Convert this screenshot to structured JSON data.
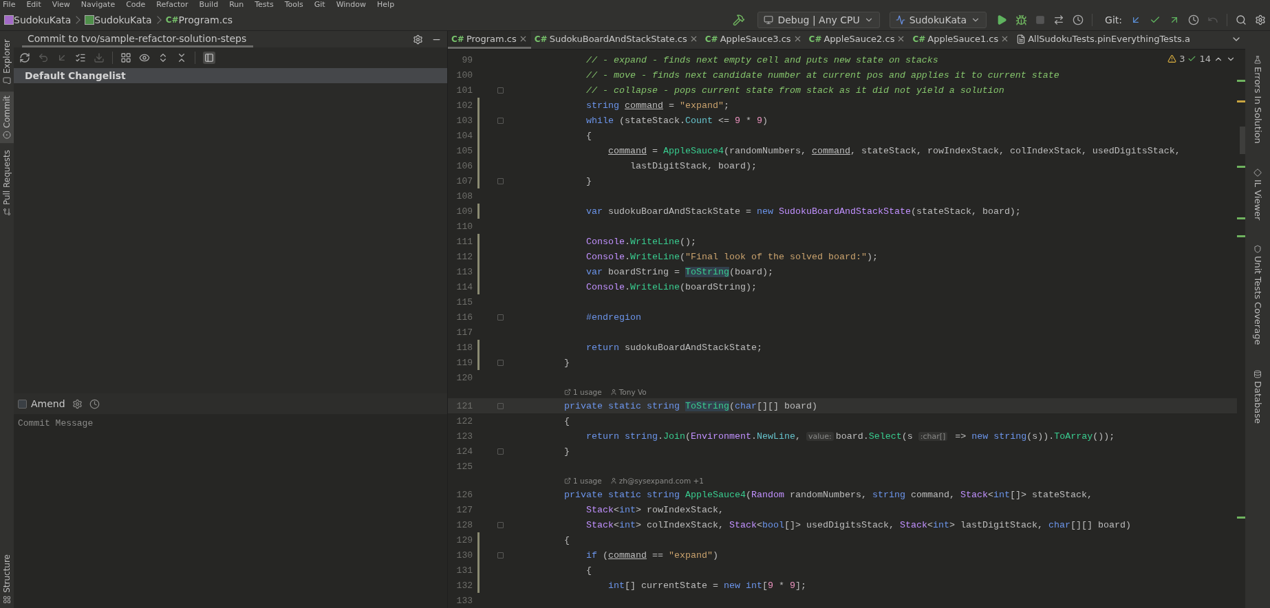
{
  "menu": [
    "File",
    "Edit",
    "View",
    "Navigate",
    "Code",
    "Refactor",
    "Build",
    "Run",
    "Tests",
    "Tools",
    "Git",
    "Window",
    "Help"
  ],
  "breadcrumbs": [
    {
      "kind": "solution",
      "label": "SudokuKata"
    },
    {
      "kind": "project",
      "label": "SudokuKata"
    },
    {
      "kind": "file",
      "badge": "C#",
      "label": "Program.cs"
    }
  ],
  "toolbar": {
    "build_config": "Debug | Any CPU",
    "run_config": "SudokuKata",
    "git_label": "Git:"
  },
  "left_stripe": [
    {
      "label": "Explorer",
      "selected": false
    },
    {
      "label": "Commit",
      "selected": true
    },
    {
      "label": "Pull Requests",
      "selected": false
    }
  ],
  "left_stripe_bottom": [
    "Structure"
  ],
  "commit_panel": {
    "title": "Commit to tvo/sample-refactor-solution-steps",
    "changelists": [
      {
        "label": "Default Changelist",
        "selected": true
      }
    ],
    "amend": {
      "label": "Amend",
      "checked": false
    },
    "message": {
      "placeholder": "Commit Message"
    }
  },
  "tabs": [
    {
      "badge": "C#",
      "label": "Program.cs",
      "selected": true,
      "closable": true
    },
    {
      "badge": "C#",
      "label": "SudokuBoardAndStackState.cs",
      "selected": false,
      "closable": true
    },
    {
      "badge": "C#",
      "label": "AppleSauce3.cs",
      "selected": false,
      "closable": true
    },
    {
      "badge": "C#",
      "label": "AppleSauce2.cs",
      "selected": false,
      "closable": true
    },
    {
      "badge": "C#",
      "label": "AppleSauce1.cs",
      "selected": false,
      "closable": true
    },
    {
      "label": "AllSudokuTests.pinEverythingTests.a",
      "selected": false,
      "closable": false
    }
  ],
  "inspections": {
    "warnings": "3",
    "passed": "14"
  },
  "lines": [
    {
      "kind": "code",
      "number": "99",
      "modified": false,
      "fold": false,
      "tokens": [
        {
          "kind": "comment",
          "t": "            // - expand - finds next empty cell and puts new state on stacks"
        }
      ]
    },
    {
      "kind": "code",
      "number": "100",
      "modified": false,
      "fold": false,
      "tokens": [
        {
          "kind": "comment",
          "t": "            // - move - finds next candidate number at current pos and applies it to current state"
        }
      ]
    },
    {
      "kind": "code",
      "number": "101",
      "modified": false,
      "fold": true,
      "tokens": [
        {
          "kind": "comment",
          "t": "            // - collapse - pops current state from stack as it did not yield a solution"
        }
      ]
    },
    {
      "kind": "code",
      "number": "102",
      "modified": true,
      "fold": false,
      "tokens": [
        {
          "kind": "kw",
          "t": "            string "
        },
        {
          "kind": "ul",
          "t": "command"
        },
        {
          "kind": "plain",
          "t": " = "
        },
        {
          "kind": "str",
          "t": "\"expand\""
        },
        {
          "kind": "plain",
          "t": ";"
        }
      ]
    },
    {
      "kind": "code",
      "number": "103",
      "modified": true,
      "fold": true,
      "tokens": [
        {
          "kind": "kw",
          "t": "            while"
        },
        {
          "kind": "plain",
          "t": " (stateStack."
        },
        {
          "kind": "field",
          "t": "Count"
        },
        {
          "kind": "plain",
          "t": " <= "
        },
        {
          "kind": "num",
          "t": "9"
        },
        {
          "kind": "plain",
          "t": " * "
        },
        {
          "kind": "num",
          "t": "9"
        },
        {
          "kind": "plain",
          "t": ")"
        }
      ]
    },
    {
      "kind": "code",
      "number": "104",
      "modified": true,
      "fold": false,
      "tokens": [
        {
          "kind": "plain",
          "t": "            {"
        }
      ]
    },
    {
      "kind": "code",
      "number": "105",
      "modified": true,
      "fold": false,
      "tokens": [
        {
          "kind": "ul",
          "t": "                command"
        },
        {
          "kind": "plain",
          "t": " = "
        },
        {
          "kind": "method",
          "t": "AppleSauce4"
        },
        {
          "kind": "plain",
          "t": "(randomNumbers, "
        },
        {
          "kind": "ul",
          "t": "command"
        },
        {
          "kind": "plain",
          "t": ", stateStack, rowIndexStack, colIndexStack, usedDigitsStack,"
        }
      ]
    },
    {
      "kind": "code",
      "number": "106",
      "modified": true,
      "fold": false,
      "tokens": [
        {
          "kind": "plain",
          "t": "                    lastDigitStack, board);"
        }
      ]
    },
    {
      "kind": "code",
      "number": "107",
      "modified": true,
      "fold": true,
      "tokens": [
        {
          "kind": "plain",
          "t": "            }"
        }
      ]
    },
    {
      "kind": "code",
      "number": "108",
      "modified": false,
      "fold": false
    },
    {
      "kind": "code",
      "number": "109",
      "modified": true,
      "fold": false,
      "tokens": [
        {
          "kind": "kw",
          "t": "            var"
        },
        {
          "kind": "plain",
          "t": " sudokuBoardAndStackState = "
        },
        {
          "kind": "kw",
          "t": "new "
        },
        {
          "kind": "type",
          "t": "SudokuBoardAndStackState"
        },
        {
          "kind": "plain",
          "t": "(stateStack, board);"
        }
      ]
    },
    {
      "kind": "code",
      "number": "110",
      "modified": false,
      "fold": false
    },
    {
      "kind": "code",
      "number": "111",
      "modified": true,
      "fold": false,
      "tokens": [
        {
          "kind": "type",
          "t": "            Console"
        },
        {
          "kind": "plain",
          "t": "."
        },
        {
          "kind": "method",
          "t": "WriteLine"
        },
        {
          "kind": "plain",
          "t": "();"
        }
      ]
    },
    {
      "kind": "code",
      "number": "112",
      "modified": true,
      "fold": false,
      "tokens": [
        {
          "kind": "type",
          "t": "            Console"
        },
        {
          "kind": "plain",
          "t": "."
        },
        {
          "kind": "method",
          "t": "WriteLine"
        },
        {
          "kind": "plain",
          "t": "("
        },
        {
          "kind": "str",
          "t": "\"Final look of the solved board:\""
        },
        {
          "kind": "plain",
          "t": ");"
        }
      ]
    },
    {
      "kind": "code",
      "number": "113",
      "modified": true,
      "fold": false,
      "tokens": [
        {
          "kind": "kw",
          "t": "            var"
        },
        {
          "kind": "plain",
          "t": " boardString = "
        },
        {
          "kind": "hl",
          "t": "ToString"
        },
        {
          "kind": "plain",
          "t": "(board);"
        }
      ]
    },
    {
      "kind": "code",
      "number": "114",
      "modified": true,
      "fold": false,
      "tokens": [
        {
          "kind": "type",
          "t": "            Console"
        },
        {
          "kind": "plain",
          "t": "."
        },
        {
          "kind": "method",
          "t": "WriteLine"
        },
        {
          "kind": "plain",
          "t": "(boardString);"
        }
      ]
    },
    {
      "kind": "code",
      "number": "115",
      "modified": false,
      "fold": false
    },
    {
      "kind": "code",
      "number": "116",
      "modified": false,
      "fold": true,
      "tokens": [
        {
          "kind": "kw",
          "t": "            #endregion"
        }
      ]
    },
    {
      "kind": "code",
      "number": "117",
      "modified": false,
      "fold": false
    },
    {
      "kind": "code",
      "number": "118",
      "modified": true,
      "fold": false,
      "tokens": [
        {
          "kind": "kw",
          "t": "            return"
        },
        {
          "kind": "plain",
          "t": " sudokuBoardAndStackState;"
        }
      ]
    },
    {
      "kind": "code",
      "number": "119",
      "modified": true,
      "fold": true,
      "tokens": [
        {
          "kind": "plain",
          "t": "        }"
        }
      ]
    },
    {
      "kind": "code",
      "number": "120",
      "modified": false,
      "fold": false
    },
    {
      "kind": "lens",
      "usages": "1 usage",
      "author": "Tony Vo"
    },
    {
      "kind": "code",
      "number": "121",
      "modified": false,
      "fold": true,
      "current": true,
      "tokens": [
        {
          "kind": "kw",
          "t": "        private static string "
        },
        {
          "kind": "hl",
          "t": "ToString"
        },
        {
          "kind": "plain",
          "t": "("
        },
        {
          "kind": "kw",
          "t": "char"
        },
        {
          "kind": "plain",
          "t": "[][] board)"
        }
      ]
    },
    {
      "kind": "code",
      "number": "122",
      "modified": false,
      "fold": false,
      "tokens": [
        {
          "kind": "plain",
          "t": "        {"
        }
      ]
    },
    {
      "kind": "code",
      "number": "123",
      "modified": false,
      "fold": false,
      "tokens": [
        {
          "kind": "kw",
          "t": "            return string"
        },
        {
          "kind": "plain",
          "t": "."
        },
        {
          "kind": "method",
          "t": "Join"
        },
        {
          "kind": "plain",
          "t": "("
        },
        {
          "kind": "type",
          "t": "Environment"
        },
        {
          "kind": "plain",
          "t": "."
        },
        {
          "kind": "field",
          "t": "NewLine"
        },
        {
          "kind": "plain",
          "t": ","
        },
        {
          "kind": "hint",
          "t": "value:"
        },
        {
          "kind": "plain",
          "t": "board."
        },
        {
          "kind": "method",
          "t": "Select"
        },
        {
          "kind": "plain",
          "t": "(s"
        },
        {
          "kind": "hint",
          "t": ":char[]"
        },
        {
          "kind": "plain",
          "t": " => "
        },
        {
          "kind": "kw",
          "t": "new string"
        },
        {
          "kind": "plain",
          "t": "(s))."
        },
        {
          "kind": "method",
          "t": "ToArray"
        },
        {
          "kind": "plain",
          "t": "());"
        }
      ]
    },
    {
      "kind": "code",
      "number": "124",
      "modified": false,
      "fold": true,
      "tokens": [
        {
          "kind": "plain",
          "t": "        }"
        }
      ]
    },
    {
      "kind": "code",
      "number": "125",
      "modified": false,
      "fold": false
    },
    {
      "kind": "lens",
      "usages": "1 usage",
      "author": "zh@sysexpand.com +1"
    },
    {
      "kind": "code",
      "number": "126",
      "modified": false,
      "fold": false,
      "tokens": [
        {
          "kind": "kw",
          "t": "        private static string "
        },
        {
          "kind": "method",
          "t": "AppleSauce4"
        },
        {
          "kind": "plain",
          "t": "("
        },
        {
          "kind": "type",
          "t": "Random"
        },
        {
          "kind": "plain",
          "t": " randomNumbers, "
        },
        {
          "kind": "kw",
          "t": "string"
        },
        {
          "kind": "plain",
          "t": " command, "
        },
        {
          "kind": "type",
          "t": "Stack"
        },
        {
          "kind": "plain",
          "t": "<"
        },
        {
          "kind": "kw",
          "t": "int"
        },
        {
          "kind": "plain",
          "t": "[]> stateStack,"
        }
      ]
    },
    {
      "kind": "code",
      "number": "127",
      "modified": false,
      "fold": false,
      "tokens": [
        {
          "kind": "type",
          "t": "            Stack"
        },
        {
          "kind": "plain",
          "t": "<"
        },
        {
          "kind": "kw",
          "t": "int"
        },
        {
          "kind": "plain",
          "t": "> rowIndexStack,"
        }
      ]
    },
    {
      "kind": "code",
      "number": "128",
      "modified": false,
      "fold": true,
      "tokens": [
        {
          "kind": "type",
          "t": "            Stack"
        },
        {
          "kind": "plain",
          "t": "<"
        },
        {
          "kind": "kw",
          "t": "int"
        },
        {
          "kind": "plain",
          "t": "> colIndexStack, "
        },
        {
          "kind": "type",
          "t": "Stack"
        },
        {
          "kind": "plain",
          "t": "<"
        },
        {
          "kind": "kw",
          "t": "bool"
        },
        {
          "kind": "plain",
          "t": "[]> usedDigitsStack, "
        },
        {
          "kind": "type",
          "t": "Stack"
        },
        {
          "kind": "plain",
          "t": "<"
        },
        {
          "kind": "kw",
          "t": "int"
        },
        {
          "kind": "plain",
          "t": "> lastDigitStack, "
        },
        {
          "kind": "kw",
          "t": "char"
        },
        {
          "kind": "plain",
          "t": "[][] board)"
        }
      ]
    },
    {
      "kind": "code",
      "number": "129",
      "modified": true,
      "fold": false,
      "tokens": [
        {
          "kind": "plain",
          "t": "        {"
        }
      ]
    },
    {
      "kind": "code",
      "number": "130",
      "modified": true,
      "fold": true,
      "tokens": [
        {
          "kind": "kw",
          "t": "            if"
        },
        {
          "kind": "plain",
          "t": " ("
        },
        {
          "kind": "ul",
          "t": "command"
        },
        {
          "kind": "plain",
          "t": " == "
        },
        {
          "kind": "str",
          "t": "\"expand\""
        },
        {
          "kind": "plain",
          "t": ")"
        }
      ]
    },
    {
      "kind": "code",
      "number": "131",
      "modified": true,
      "fold": false,
      "tokens": [
        {
          "kind": "plain",
          "t": "            {"
        }
      ]
    },
    {
      "kind": "code",
      "number": "132",
      "modified": true,
      "fold": false,
      "tokens": [
        {
          "kind": "kw",
          "t": "                int"
        },
        {
          "kind": "plain",
          "t": "[] currentState = "
        },
        {
          "kind": "kw",
          "t": "new int"
        },
        {
          "kind": "plain",
          "t": "["
        },
        {
          "kind": "num",
          "t": "9"
        },
        {
          "kind": "plain",
          "t": " * "
        },
        {
          "kind": "num",
          "t": "9"
        },
        {
          "kind": "plain",
          "t": "];"
        }
      ]
    },
    {
      "kind": "code",
      "number": "133",
      "modified": false,
      "fold": false
    }
  ],
  "right_stripe": [
    "Errors In Solution",
    "IL Viewer",
    "Unit Tests Coverage",
    "Database"
  ]
}
